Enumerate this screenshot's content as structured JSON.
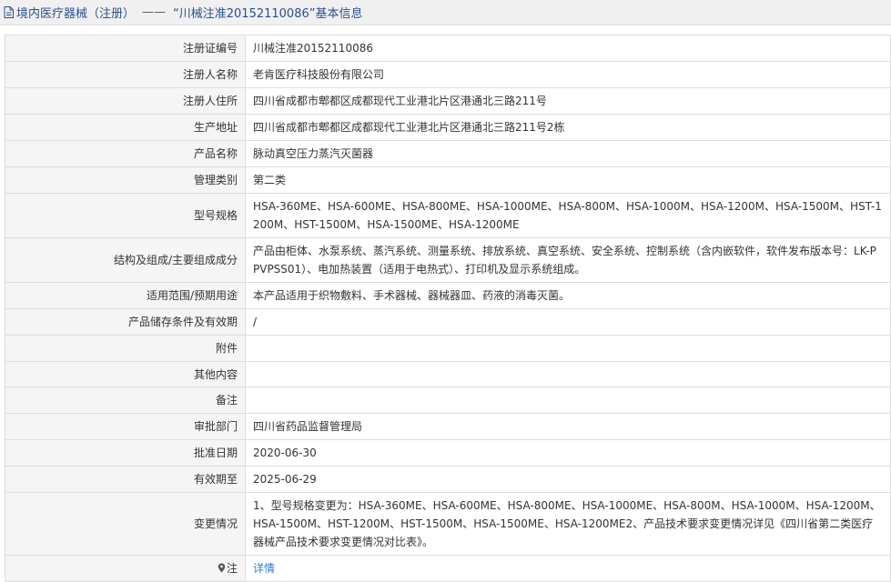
{
  "header": {
    "category": "境内医疗器械（注册）",
    "separator": "——",
    "title": "“川械注准20152110086”基本信息"
  },
  "rows": [
    {
      "label": "注册证编号",
      "value": "川械注准20152110086"
    },
    {
      "label": "注册人名称",
      "value": "老肯医疗科技股份有限公司"
    },
    {
      "label": "注册人住所",
      "value": "四川省成都市郫都区成都现代工业港北片区港通北三路211号"
    },
    {
      "label": "生产地址",
      "value": "四川省成都市郫都区成都现代工业港北片区港通北三路211号2栋"
    },
    {
      "label": "产品名称",
      "value": "脉动真空压力蒸汽灭菌器"
    },
    {
      "label": "管理类别",
      "value": "第二类"
    },
    {
      "label": "型号规格",
      "value": "HSA-360ME、HSA-600ME、HSA-800ME、HSA-1000ME、HSA-800M、HSA-1000M、HSA-1200M、HSA-1500M、HST-1200M、HST-1500M、HSA-1500ME、HSA-1200ME"
    },
    {
      "label": "结构及组成/主要组成成分",
      "value": "产品由柜体、水泵系统、蒸汽系统、测量系统、排放系统、真空系统、安全系统、控制系统（含内嵌软件，软件发布版本号：LK-PPVPSS01）、电加热装置（适用于电热式）、打印机及显示系统组成。"
    },
    {
      "label": "适用范围/预期用途",
      "value": "本产品适用于织物敷料、手术器械、器械器皿、药液的消毒灭菌。"
    },
    {
      "label": "产品储存条件及有效期",
      "value": "/"
    },
    {
      "label": "附件",
      "value": ""
    },
    {
      "label": "其他内容",
      "value": ""
    },
    {
      "label": "备注",
      "value": ""
    },
    {
      "label": "审批部门",
      "value": "四川省药品监督管理局"
    },
    {
      "label": "批准日期",
      "value": "2020-06-30"
    },
    {
      "label": "有效期至",
      "value": "2025-06-29"
    },
    {
      "label": "变更情况",
      "value": "1、型号规格变更为：HSA-360ME、HSA-600ME、HSA-800ME、HSA-1000ME、HSA-800M、HSA-1000M、HSA-1200M、HSA-1500M、HST-1200M、HST-1500M、HSA-1500ME、HSA-1200ME2、产品技术要求变更情况详见《四川省第二类医疗器械产品技术要求变更情况对比表》。"
    }
  ],
  "note": {
    "label": "注",
    "link_text": "详情"
  },
  "colors": {
    "title": "#2a4f8f",
    "link": "#2a7bd6",
    "label_bg": "#f5f5f5",
    "border": "#dddddd"
  }
}
